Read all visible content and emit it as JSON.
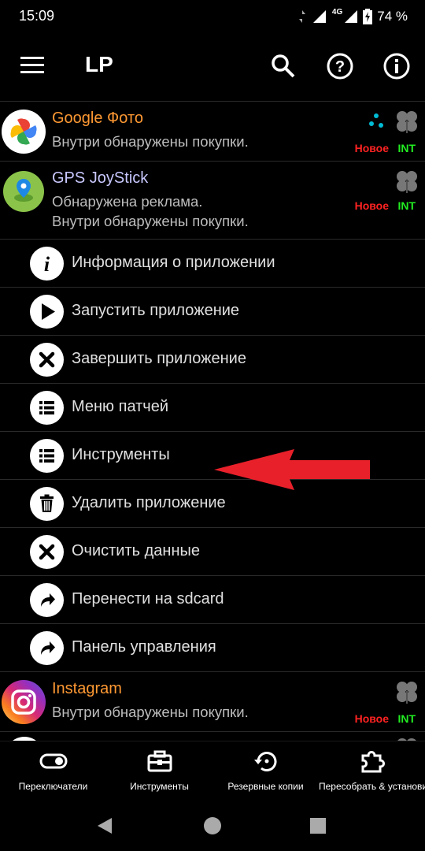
{
  "status_bar": {
    "time": "15:09",
    "network": "4G",
    "battery": "74 %"
  },
  "app_bar": {
    "title": "LP",
    "icons": [
      "hamburger-menu-icon",
      "search-icon",
      "help-icon",
      "info-icon"
    ]
  },
  "apps": [
    {
      "name": "Google Фото",
      "name_color": "#ff9933",
      "desc": [
        "Внутри обнаружены покупки."
      ],
      "badge_new": "Новое",
      "badge_int": "INT"
    },
    {
      "name": "GPS JoyStick",
      "name_color": "#c8c8ff",
      "desc": [
        "Обнаружена реклама.",
        "Внутри обнаружены покупки."
      ],
      "badge_new": "Новое",
      "badge_int": "INT"
    },
    {
      "name": "Instagram",
      "name_color": "#ff9933",
      "desc": [
        "Внутри обнаружены покупки."
      ],
      "badge_new": "Новое",
      "badge_int": "INT"
    }
  ],
  "context_menu": [
    {
      "label": "Информация о приложении",
      "icon": "info-i-icon"
    },
    {
      "label": "Запустить приложение",
      "icon": "play-icon"
    },
    {
      "label": "Завершить приложение",
      "icon": "close-icon"
    },
    {
      "label": "Меню патчей",
      "icon": "list-icon"
    },
    {
      "label": "Инструменты",
      "icon": "list-icon"
    },
    {
      "label": "Удалить приложение",
      "icon": "trash-icon"
    },
    {
      "label": "Очистить данные",
      "icon": "close-icon"
    },
    {
      "label": "Перенести на sdcard",
      "icon": "share-arrow-icon"
    },
    {
      "label": "Панель управления",
      "icon": "share-arrow-icon"
    }
  ],
  "bottom_nav": [
    {
      "label": "Переключатели",
      "icon": "toggle-icon"
    },
    {
      "label": "Инструменты",
      "icon": "toolbox-icon"
    },
    {
      "label": "Резервные копии",
      "icon": "backup-restore-icon"
    },
    {
      "label": "Пересобрать & установить",
      "icon": "puzzle-icon"
    }
  ],
  "colors": {
    "accent_orange": "#ff9933",
    "badge_red": "#ff2222",
    "badge_green": "#22ee22",
    "arrow_red": "#e8202a"
  }
}
